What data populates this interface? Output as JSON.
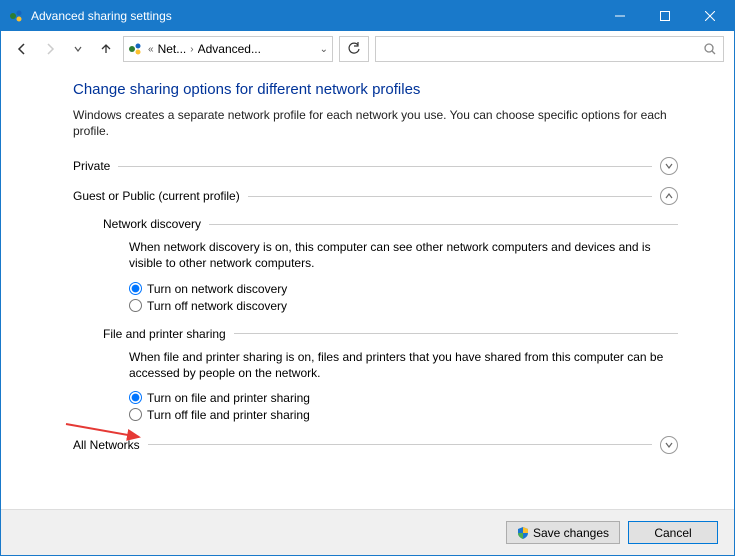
{
  "window": {
    "title": "Advanced sharing settings"
  },
  "breadcrumb": {
    "first": "Net...",
    "second": "Advanced..."
  },
  "search": {
    "placeholder": ""
  },
  "page": {
    "heading": "Change sharing options for different network profiles",
    "description": "Windows creates a separate network profile for each network you use. You can choose specific options for each profile."
  },
  "sections": {
    "private": {
      "label": "Private"
    },
    "guest": {
      "label": "Guest or Public (current profile)",
      "network_discovery": {
        "title": "Network discovery",
        "desc": "When network discovery is on, this computer can see other network computers and devices and is visible to other network computers.",
        "on": "Turn on network discovery",
        "off": "Turn off network discovery"
      },
      "file_printer": {
        "title": "File and printer sharing",
        "desc": "When file and printer sharing is on, files and printers that you have shared from this computer can be accessed by people on the network.",
        "on": "Turn on file and printer sharing",
        "off": "Turn off file and printer sharing"
      }
    },
    "all": {
      "label": "All Networks"
    }
  },
  "footer": {
    "save": "Save changes",
    "cancel": "Cancel"
  }
}
